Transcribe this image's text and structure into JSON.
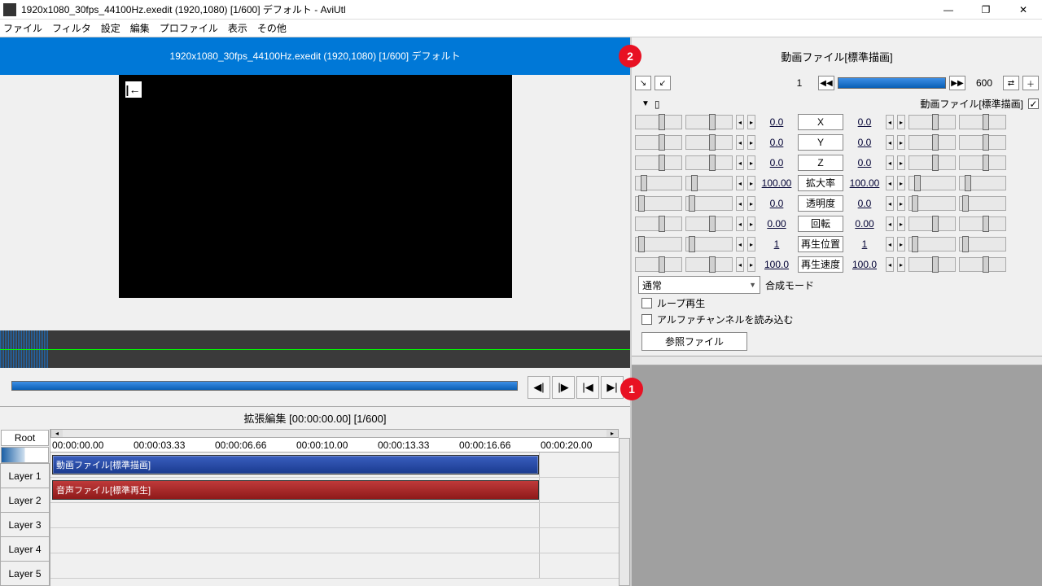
{
  "title": "1920x1080_30fps_44100Hz.exedit (1920,1080)  [1/600]  デフォルト - AviUtl",
  "menubar": [
    "ファイル",
    "フィルタ",
    "設定",
    "編集",
    "プロファイル",
    "表示",
    "その他"
  ],
  "preview_header": "1920x1080_30fps_44100Hz.exedit (1920,1080)  [1/600]  デフォルト",
  "badge1": "1",
  "badge2": "2",
  "timeline_title": "拡張編集 [00:00:00.00] [1/600]",
  "root": "Root",
  "layers": [
    "Layer 1",
    "Layer 2",
    "Layer 3",
    "Layer 4",
    "Layer 5"
  ],
  "ruler": [
    "00:00:00.00",
    "00:00:03.33",
    "00:00:06.66",
    "00:00:10.00",
    "00:00:13.33",
    "00:00:16.66",
    "00:00:20.00"
  ],
  "clip_video": "動画ファイル[標準描画]",
  "clip_audio": "音声ファイル[標準再生]",
  "props": {
    "title": "動画ファイル[標準描画]",
    "frame_start": "1",
    "frame_end": "600",
    "obj_label": "動画ファイル[標準描画]",
    "rows": [
      {
        "l": "0.0",
        "label": "X",
        "r": "0.0",
        "tl": 50,
        "tr": 50
      },
      {
        "l": "0.0",
        "label": "Y",
        "r": "0.0",
        "tl": 50,
        "tr": 50
      },
      {
        "l": "0.0",
        "label": "Z",
        "r": "0.0",
        "tl": 50,
        "tr": 50
      },
      {
        "l": "100.00",
        "label": "拡大率",
        "r": "100.00",
        "tl": 10,
        "tr": 10
      },
      {
        "l": "0.0",
        "label": "透明度",
        "r": "0.0",
        "tl": 5,
        "tr": 5
      },
      {
        "l": "0.00",
        "label": "回転",
        "r": "0.00",
        "tl": 50,
        "tr": 50
      },
      {
        "l": "1",
        "label": "再生位置",
        "r": "1",
        "tl": 5,
        "tr": 5
      },
      {
        "l": "100.0",
        "label": "再生速度",
        "r": "100.0",
        "tl": 50,
        "tr": 50
      }
    ],
    "blend_label": "合成モード",
    "blend_value": "通常",
    "chk1": "ループ再生",
    "chk2": "アルファチャンネルを読み込む",
    "ref": "参照ファイル"
  }
}
